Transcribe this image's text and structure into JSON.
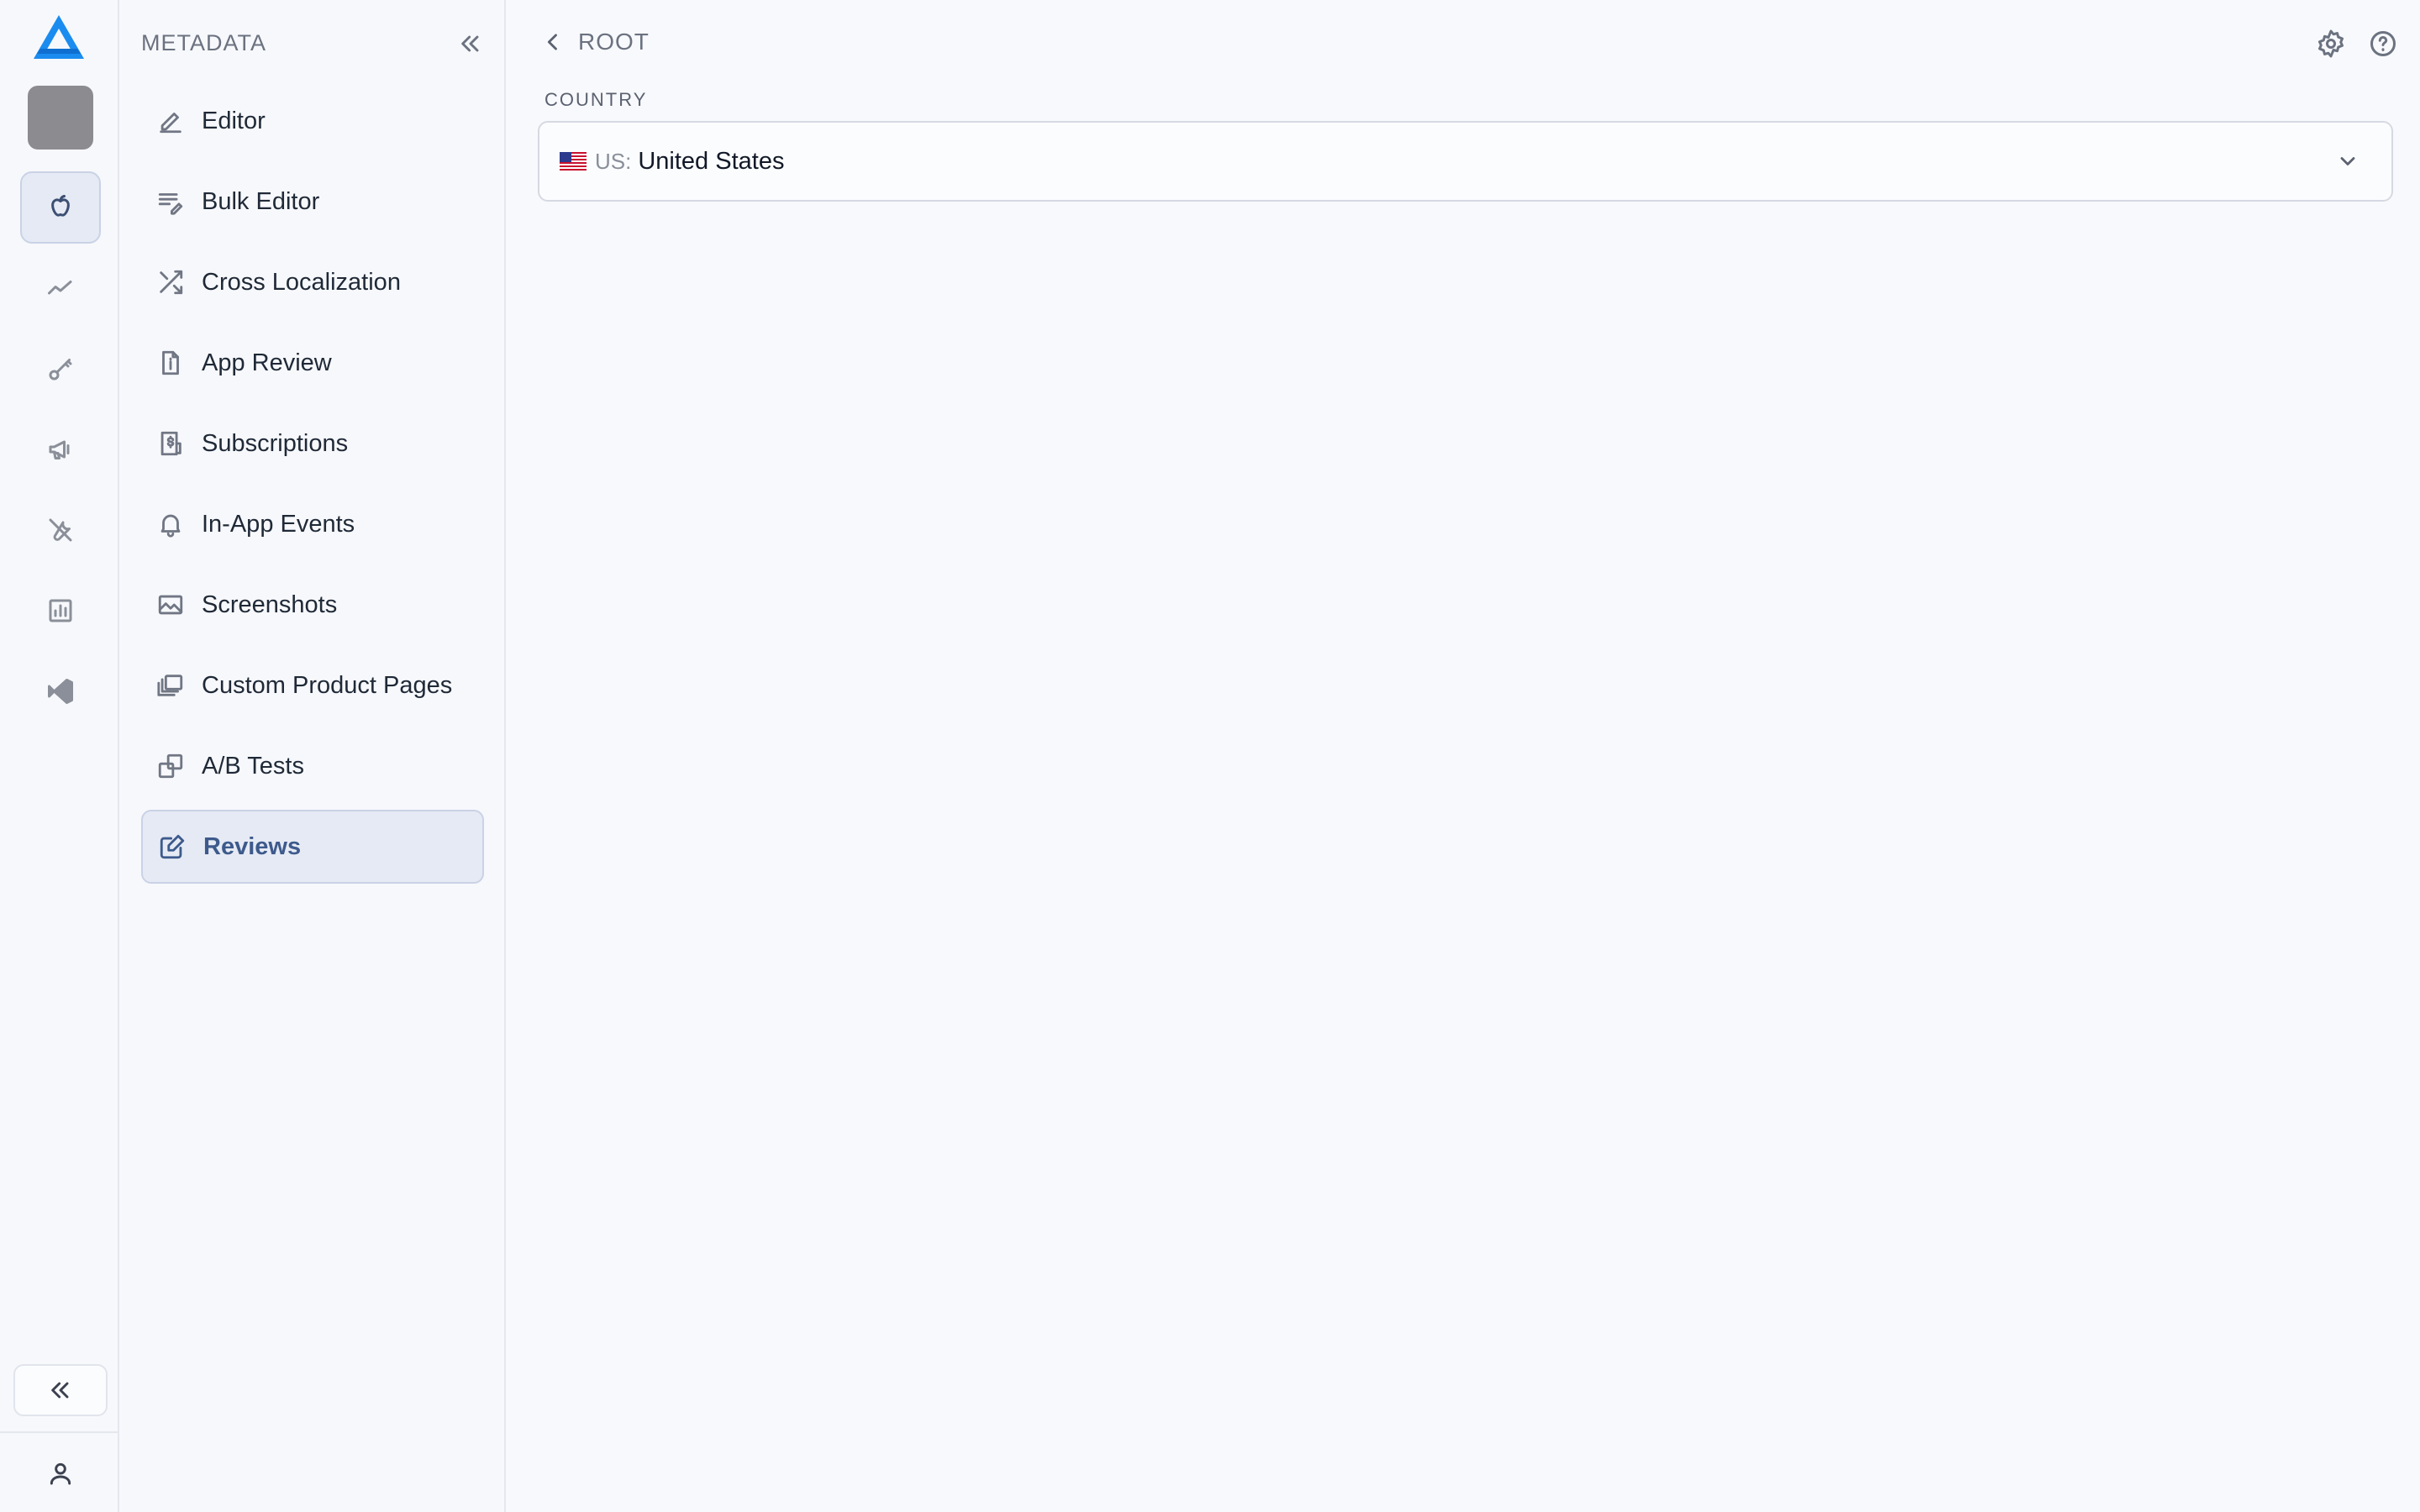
{
  "rail": {
    "items": [
      {
        "name": "apple-icon",
        "active": true
      },
      {
        "name": "trend-icon",
        "active": false
      },
      {
        "name": "key-icon",
        "active": false
      },
      {
        "name": "megaphone-icon",
        "active": false
      },
      {
        "name": "tools-icon",
        "active": false
      },
      {
        "name": "bar-chart-icon",
        "active": false
      },
      {
        "name": "vscode-icon",
        "active": false
      }
    ],
    "collapse_icon": "chevrons-left-icon",
    "user_icon": "user-icon"
  },
  "sidebar": {
    "title": "METADATA",
    "items": [
      {
        "label": "Editor",
        "icon": "pencil-icon"
      },
      {
        "label": "Bulk Editor",
        "icon": "bulk-edit-icon"
      },
      {
        "label": "Cross Localization",
        "icon": "shuffle-icon"
      },
      {
        "label": "App Review",
        "icon": "file-info-icon"
      },
      {
        "label": "Subscriptions",
        "icon": "receipt-dollar-icon"
      },
      {
        "label": "In-App Events",
        "icon": "bell-icon"
      },
      {
        "label": "Screenshots",
        "icon": "image-icon"
      },
      {
        "label": "Custom Product Pages",
        "icon": "stacked-pages-icon"
      },
      {
        "label": "A/B Tests",
        "icon": "ab-squares-icon"
      },
      {
        "label": "Reviews",
        "icon": "edit-review-icon",
        "active": true
      }
    ]
  },
  "header": {
    "breadcrumb": "ROOT",
    "settings_icon": "gear-icon",
    "help_icon": "help-icon"
  },
  "country": {
    "label": "COUNTRY",
    "code": "US:",
    "value": "United States",
    "flag_icon": "us-flag-icon"
  },
  "colors": {
    "accent": "#3d5a8c",
    "active_bg": "#e6eaf4",
    "logo_blue": "#1a8cf0"
  }
}
